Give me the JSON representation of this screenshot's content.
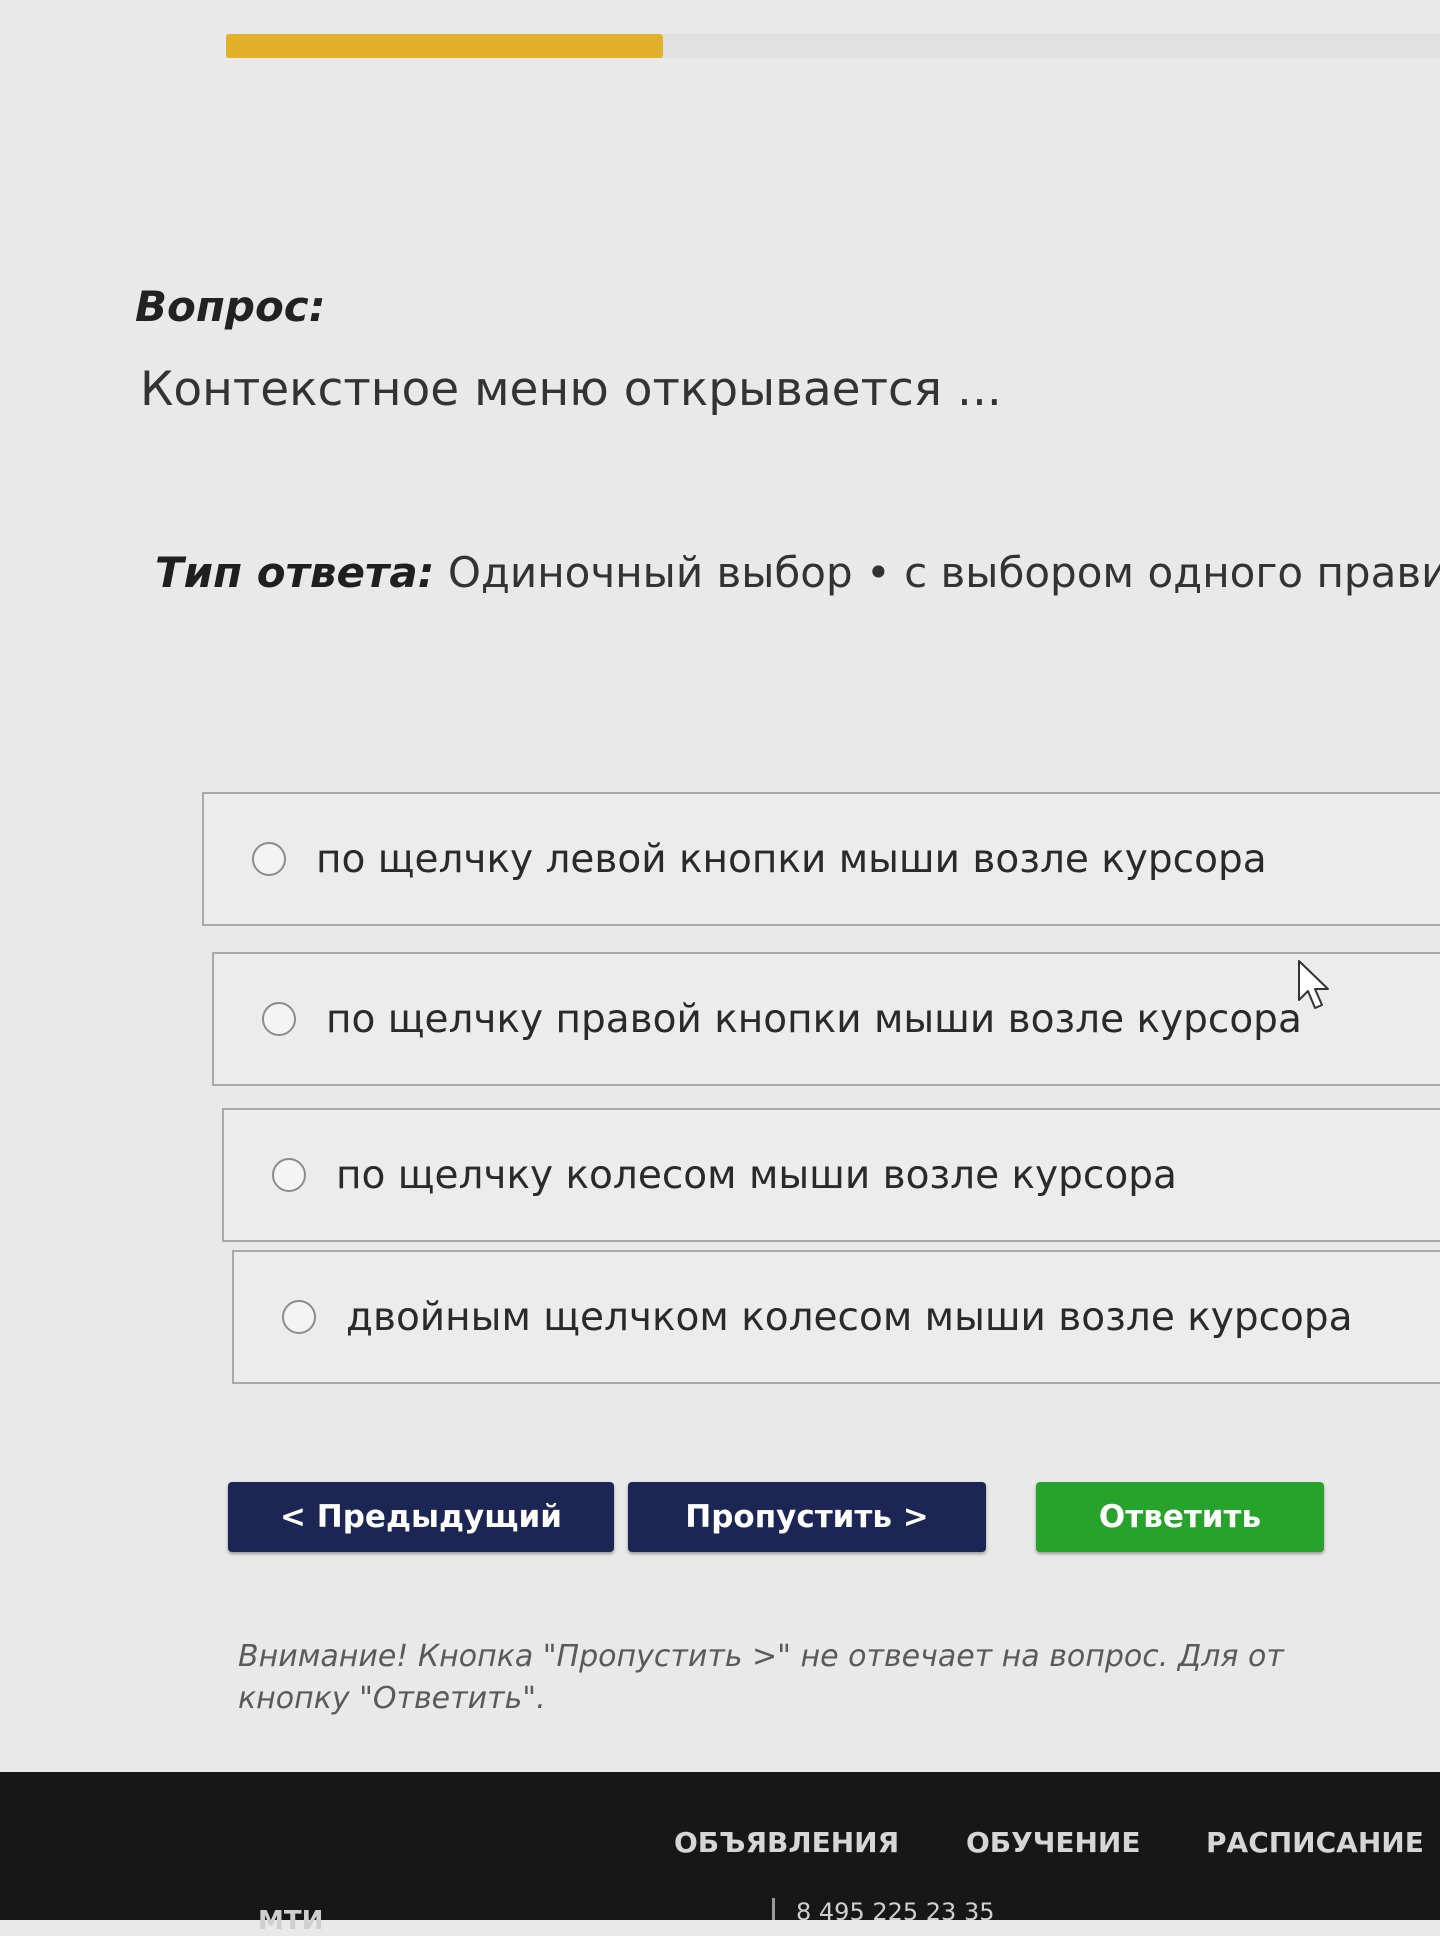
{
  "progress": {
    "percent": 36
  },
  "question": {
    "label": "Вопрос:",
    "text": "Контекстное меню открывается ..."
  },
  "answer_type": {
    "label": "Тип ответа:",
    "value": "Одиночный выбор • с выбором одного правил"
  },
  "options": [
    {
      "text": "по щелчку левой кнопки мыши возле курсора",
      "selected": false
    },
    {
      "text": "по щелчку правой кнопки мыши возле курсора",
      "selected": false
    },
    {
      "text": "по щелчку колесом мыши возле курсора",
      "selected": false
    },
    {
      "text": "двойным щелчком колесом мыши возле курсора",
      "selected": false
    }
  ],
  "buttons": {
    "prev": "< Предыдущий",
    "skip": "Пропустить >",
    "answer": "Ответить"
  },
  "notice": {
    "line1": "Внимание! Кнопка \"Пропустить >\" не отвечает на вопрос. Для от",
    "line2": "кнопку \"Ответить\"."
  },
  "footer": {
    "nav": [
      "ОБЪЯВЛЕНИЯ",
      "ОБУЧЕНИЕ",
      "РАСПИСАНИЕ"
    ],
    "phone": "8 495 225 23 35",
    "brand": "МТИ"
  },
  "colors": {
    "progress": "#e2b12b",
    "nav_button": "#1c2654",
    "answer_button": "#27a22a",
    "footer_bg": "#171717"
  }
}
